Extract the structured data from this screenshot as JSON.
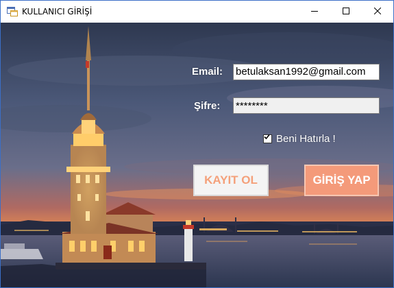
{
  "window": {
    "title": "KULLANICI GİRİŞİ",
    "app_icon": "form-icon",
    "controls": {
      "minimize": "minimize-icon",
      "maximize": "maximize-icon",
      "close": "close-icon"
    }
  },
  "form": {
    "email_label": "Email:",
    "email_value": "betulaksan1992@gmail.com",
    "password_label": "Şifre:",
    "password_value": "********",
    "remember_label": "Beni Hatırla !",
    "remember_checked": true,
    "register_button": "KAYIT OL",
    "login_button": "GİRİŞ YAP"
  },
  "background": {
    "image": "Maiden's Tower at dusk, Istanbul",
    "colors": {
      "sky": "#3d4a6a",
      "sunset": "#e0784a",
      "water": "#3a4664",
      "lights": "#f6b24a"
    }
  },
  "colors": {
    "register_text": "#f4a07a",
    "login_bg": "#f49a7a",
    "login_text": "#ffffff",
    "label_text": "#ffffff"
  }
}
